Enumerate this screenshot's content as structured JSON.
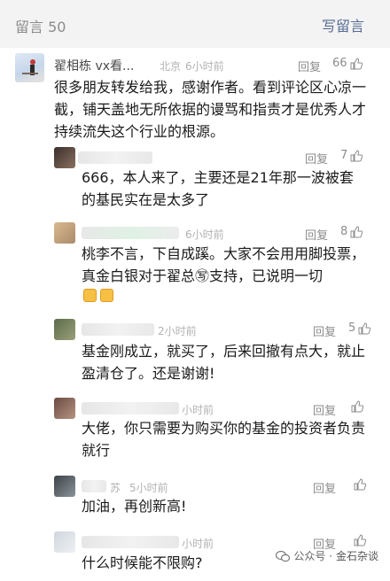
{
  "header": {
    "title": "留言 50",
    "write_label": "写留言"
  },
  "comments": [
    {
      "nickname": "翟相栋 vx看...",
      "location": "北京",
      "time": "6小时前",
      "reply_label": "回复",
      "likes": "66",
      "text": "很多朋友转发给我，感谢作者。看到评论区心凉一截，铺天盖地无所依据的谩骂和指责才是优秀人才持续流失这个行业的根源。"
    },
    {
      "time": "",
      "reply_label": "回复",
      "likes": "7",
      "text": "666，本人来了，主要还是21年那一波被套的基民实在是太多了"
    },
    {
      "time": "6小时前",
      "reply_label": "回复",
      "likes": "8",
      "text": "桃李不言，下自成蹊。大家不会用用脚投票，真金白银对于翟总㊢支持，已说明一切"
    },
    {
      "time": "2小时前",
      "reply_label": "回复",
      "likes": "5",
      "text": "基金刚成立，就买了，后来回撤有点大，就止盈清仓了。还是谢谢!"
    },
    {
      "time": "小时前",
      "reply_label": "回复",
      "likes": "",
      "text": "大佬，你只需要为购买你的基金的投资者负责就行"
    },
    {
      "name_fragment": "苏",
      "time": "5小时前",
      "reply_label": "回复",
      "likes": "",
      "text": "加油，再创新高!"
    },
    {
      "time": "小时前",
      "reply_label": "回复",
      "likes": "",
      "text": "什么时候能不限购?"
    }
  ],
  "watermark": {
    "prefix": "公众号 · ",
    "name": "金石杂谈"
  },
  "colors": {
    "link": "#576b95",
    "meta": "#b2b2b2",
    "header_bg": "#f3f3f3"
  }
}
